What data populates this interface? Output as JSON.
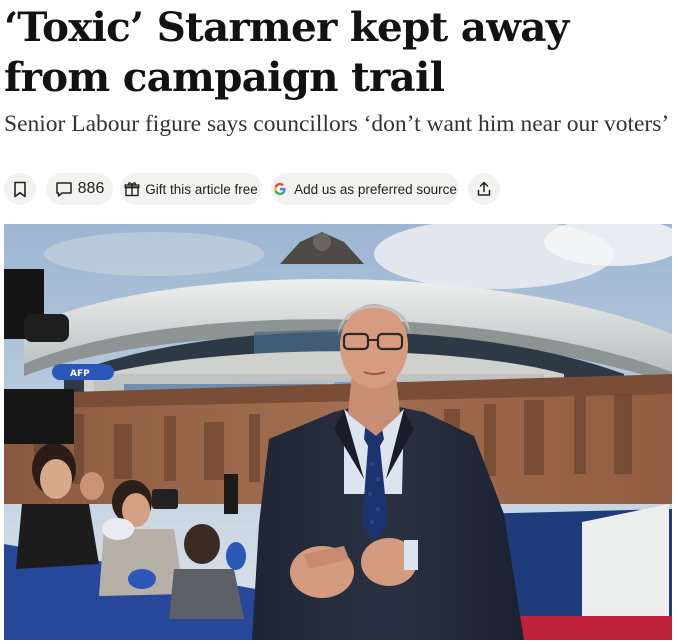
{
  "article": {
    "headline": "‘Toxic’ Starmer kept away from campaign trail",
    "standfirst": "Senior Labour figure says councillors ‘don’t want him near our voters’"
  },
  "actions": {
    "bookmark_icon": "bookmark-icon",
    "comment_icon": "speech-bubble-icon",
    "comment_count": "886",
    "gift_icon": "gift-icon",
    "gift_label": "Gift this article free",
    "google_icon": "google-g-icon",
    "source_label": "Add us as preferred source",
    "share_icon": "share-icon"
  },
  "photo": {
    "microphone_tag": "AFP"
  },
  "colors": {
    "pill_background": "#f2f2f0",
    "text": "#121212"
  }
}
